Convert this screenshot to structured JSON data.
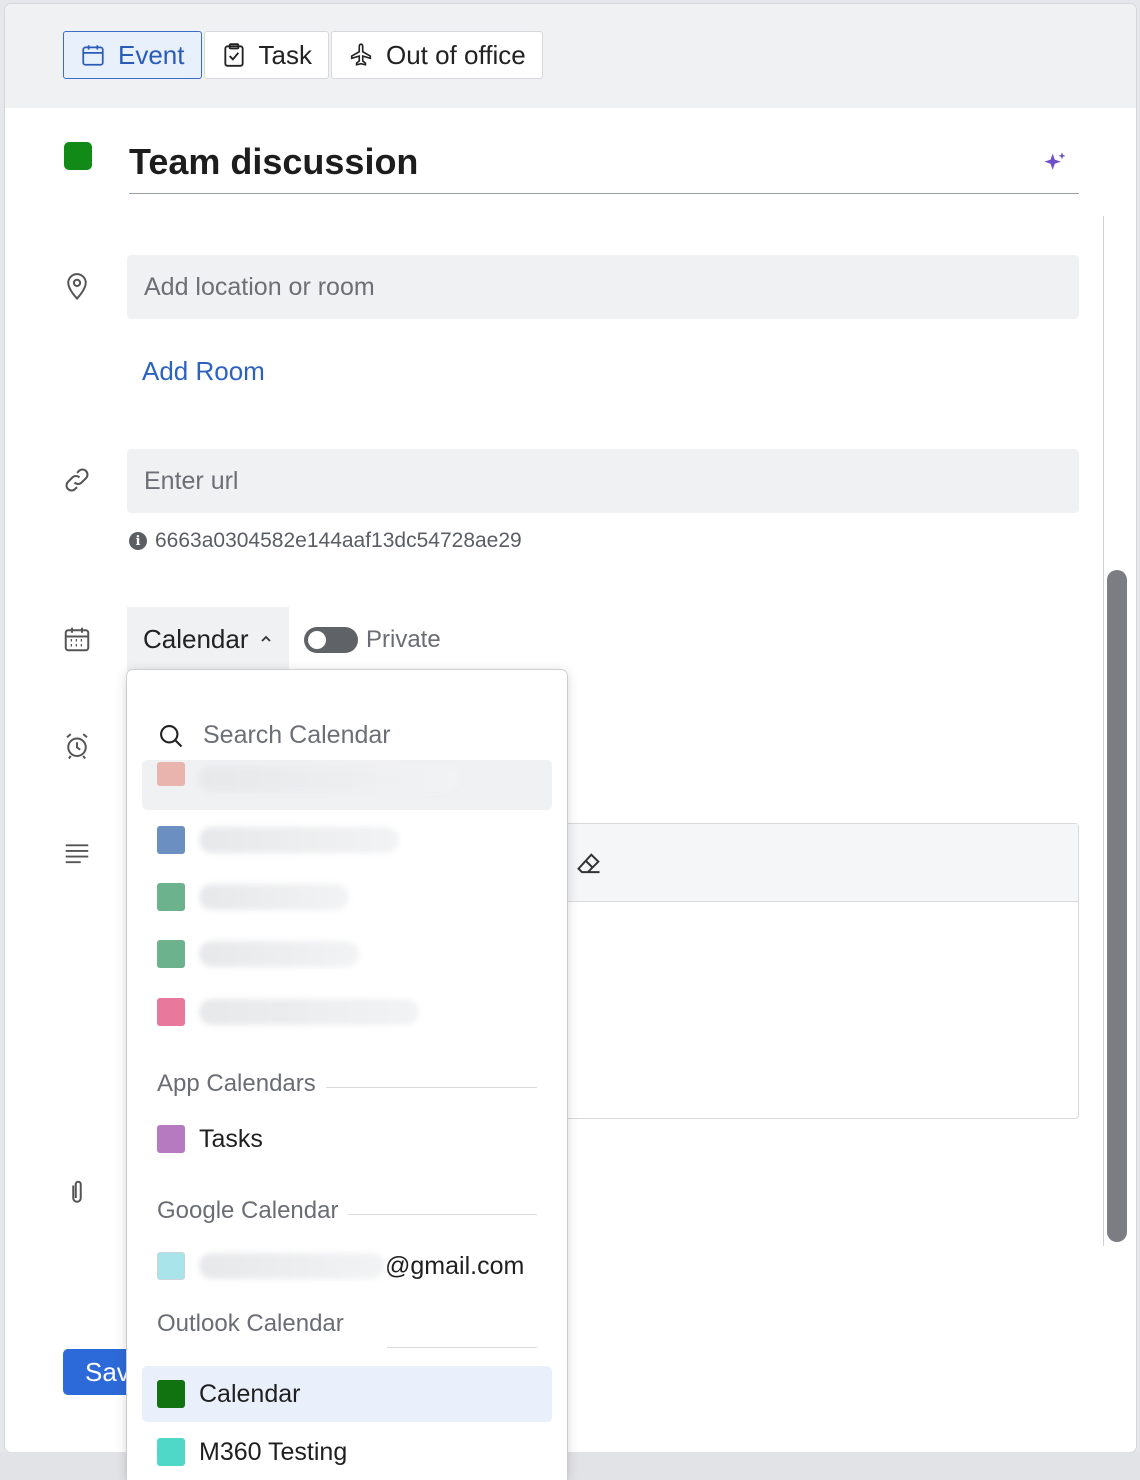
{
  "tabs": [
    {
      "label": "Event",
      "icon": "calendar-icon",
      "active": true
    },
    {
      "label": "Task",
      "icon": "clipboard-check-icon",
      "active": false
    },
    {
      "label": "Out of office",
      "icon": "airplane-icon",
      "active": false
    }
  ],
  "event": {
    "title": "Team discussion",
    "color": "#128a17"
  },
  "location": {
    "placeholder": "Add location or room",
    "add_room_label": "Add Room"
  },
  "url": {
    "placeholder": "Enter url",
    "hint": "6663a0304582e144aaf13dc54728ae29"
  },
  "calendar": {
    "select_label": "Calendar",
    "private_label": "Private",
    "private_on": false
  },
  "save_label": "Sav",
  "dropdown": {
    "search_placeholder": "Search Calendar",
    "my_calendars": [
      {
        "color": "#e8b4ad"
      },
      {
        "color": "#6a8fc0"
      },
      {
        "color": "#6cb28c"
      },
      {
        "color": "#6cb28c"
      },
      {
        "color": "#e8789c"
      }
    ],
    "app_header": "App Calendars",
    "app_items": [
      {
        "label": "Tasks",
        "color": "#b57ac0"
      }
    ],
    "google_header": "Google Calendar",
    "google_items": [
      {
        "label_suffix": "@gmail.com",
        "color": "#a8e4ea"
      }
    ],
    "outlook_header": "Outlook Calendar",
    "outlook_items": [
      {
        "label": "Calendar",
        "color": "#11730f",
        "selected": true
      },
      {
        "label": "M360 Testing",
        "color": "#4fd8c8",
        "selected": false
      }
    ]
  }
}
